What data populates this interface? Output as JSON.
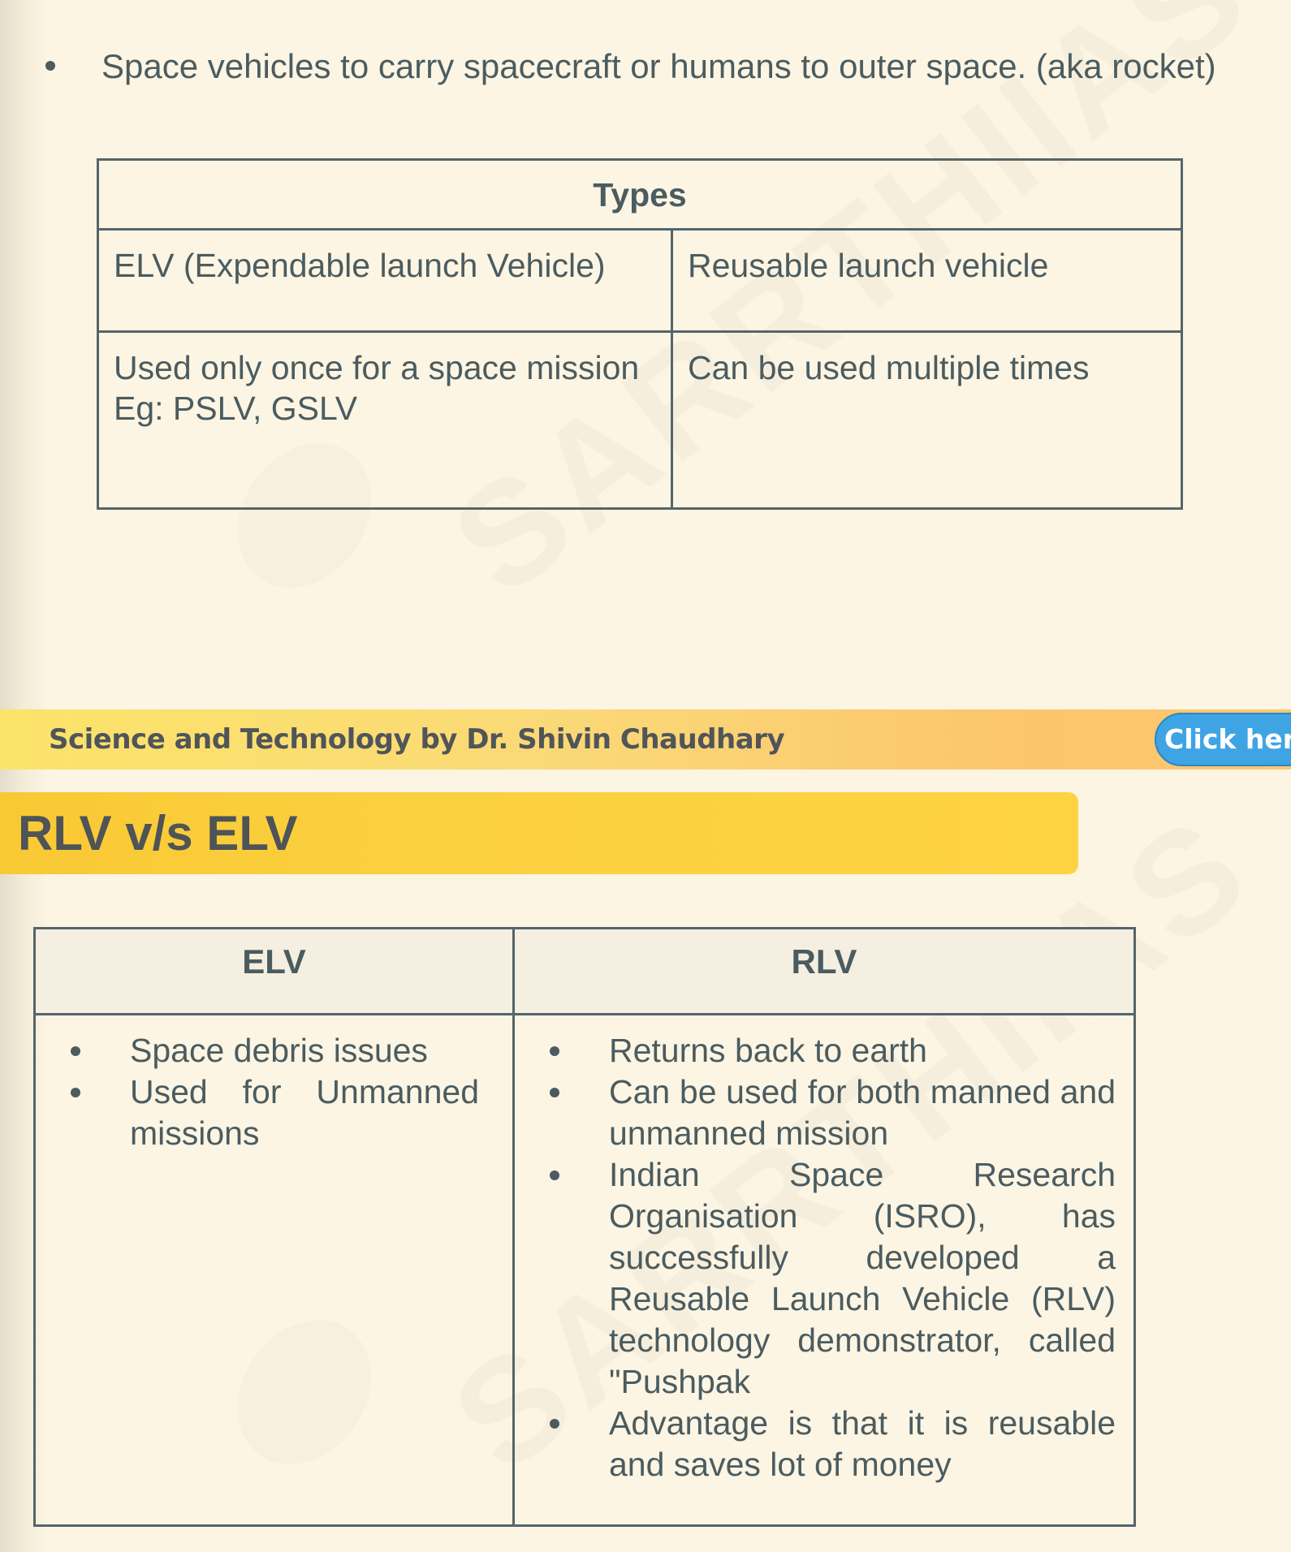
{
  "intro": {
    "bullet": "Space vehicles to carry spacecraft or humans to outer space. (aka rocket)"
  },
  "types_table": {
    "header": "Types",
    "rows": [
      [
        "ELV (Expendable launch Vehicle)",
        "Reusable launch vehicle"
      ],
      [
        "Used only once for a space mission\nEg: PSLV, GSLV",
        "Can be used multiple times"
      ]
    ]
  },
  "banner": {
    "text": "Science and Technology by Dr. Shivin Chaudhary",
    "button_label": "Click here",
    "colors": {
      "banner_start": "#fbe46a",
      "banner_end": "#fcc96f",
      "button": "#3fa4e4"
    }
  },
  "section": {
    "heading": "RLV v/s ELV",
    "heading_color": "#fed342"
  },
  "comparison_table": {
    "headers": [
      "ELV",
      "RLV"
    ],
    "elv_points": [
      "Space debris issues",
      "Used for Unmanned missions"
    ],
    "rlv_points": [
      "Returns back to  earth",
      "Can be used for both  manned and  unmanned mission",
      "Indian Space Research Organisation (ISRO), has successfully developed a Reusable Launch Vehicle (RLV) technology demonstrator, called \"Pushpak",
      "Advantage is that it is reusable and  saves lot of money"
    ]
  },
  "watermark": {
    "text": "SARRTHIIAS"
  }
}
